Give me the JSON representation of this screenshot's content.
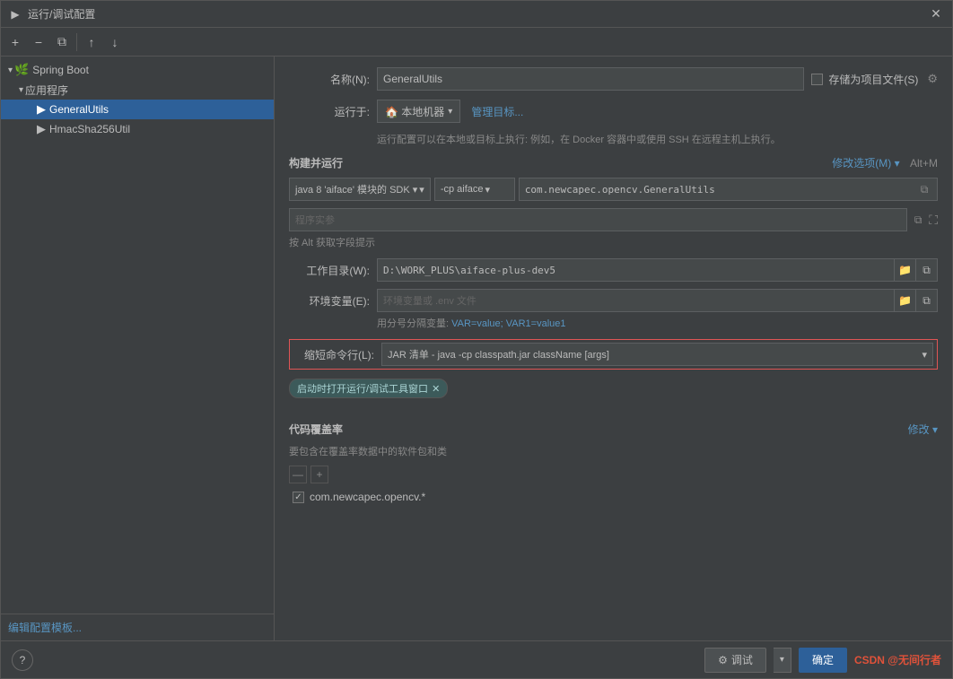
{
  "window": {
    "title": "运行/调试配置",
    "close_btn": "✕"
  },
  "toolbar": {
    "add_btn": "+",
    "remove_btn": "−",
    "copy_btn": "⧉",
    "move_up_btn": "↑",
    "move_down_btn": "↓"
  },
  "tree": {
    "spring_boot_label": "Spring Boot",
    "app_group_label": "应用程序",
    "app_group_arrow": "▾",
    "item1_label": "GeneralUtils",
    "item2_label": "HmacSha256Util"
  },
  "form": {
    "name_label": "名称(N):",
    "name_value": "GeneralUtils",
    "run_on_label": "运行于:",
    "run_on_value": "🏠 本地机器",
    "run_on_arrow": "▾",
    "manage_target_link": "管理目标...",
    "run_info_text": "运行配置可以在本地或目标上执行: 例如，在 Docker 容器中或使用 SSH 在远程主机上执行。",
    "build_run_title": "构建并运行",
    "modify_options_link": "修改选项(M) ▾",
    "modify_options_shortcut": "Alt+M",
    "sdk_label": "java 8 'aiface' 模块的 SDK ▾",
    "cp_label": "-cp aiface",
    "cp_arrow": "▾",
    "mainclass_value": "com.newcapec.opencv.GeneralUtils",
    "program_args_placeholder": "程序实参",
    "hint_text": "按 Alt 获取字段提示",
    "workdir_label": "工作目录(W):",
    "workdir_value": "D:\\WORK_PLUS\\aiface-plus-dev5",
    "env_label": "环境变量(E):",
    "env_placeholder": "环境变量或 .env 文件",
    "env_sep_text": "用分号分隔变量: VAR=value; VAR1=value1",
    "env_sep_link": "VAR=value; VAR1=value1",
    "shorten_label": "缩短命令行(L):",
    "shorten_value": "JAR 清单 - java -cp classpath.jar className [args]",
    "shorten_arrow": "▾",
    "launch_tag_label": "启动时打开运行/调试工具窗口",
    "launch_tag_close": "✕",
    "coverage_title": "代码覆盖率",
    "coverage_link": "修改 ▾",
    "coverage_subtext": "要包含在覆盖率数据中的软件包和类",
    "coverage_minus": "—",
    "coverage_plus": "+",
    "coverage_item1": "com.newcapec.opencv.*",
    "coverage_checked": "✓"
  },
  "bottom": {
    "help_btn": "?",
    "edit_template_link": "编辑配置模板...",
    "debug_btn": "调试",
    "debug_gear": "⚙",
    "debug_arrow": "▾",
    "ok_btn": "确定",
    "save_label": "存储为项目文件(S)",
    "save_gear": "⚙",
    "watermark": "CSDN @无间行者"
  }
}
